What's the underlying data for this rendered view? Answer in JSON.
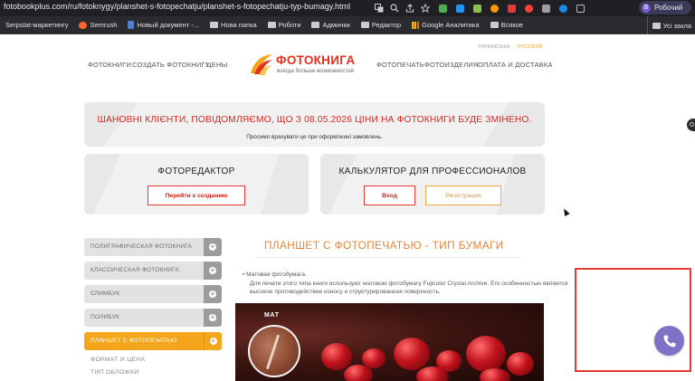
{
  "browser": {
    "url": "fotobookplus.com/ru/fotoknygy/planshet-s-fotopechatju/planshet-s-fotopechatju-typ-bumagy.html",
    "profile_initial": "В",
    "profile_label": "Робочий",
    "extensions": [
      {
        "name": "ext-icon-1",
        "color": "#4caf50"
      },
      {
        "name": "ext-icon-2",
        "color": "#2196f3"
      },
      {
        "name": "ext-icon-3",
        "color": "#8bc34a"
      },
      {
        "name": "ext-icon-4",
        "color": "#ff9800"
      },
      {
        "name": "ext-icon-5",
        "color": "#e53935"
      },
      {
        "name": "ext-icon-6",
        "color": "#f44336"
      },
      {
        "name": "ext-icon-7",
        "color": "#9e9e9e"
      },
      {
        "name": "ext-icon-8",
        "color": "#1e88e5"
      },
      {
        "name": "ext-icon-9",
        "color": "#bdbdbd"
      }
    ],
    "bookmarks": [
      {
        "label": "Serpstat-маркетингу",
        "icon": "none"
      },
      {
        "label": "Semrush",
        "icon": "sem"
      },
      {
        "label": "Новый документ -...",
        "icon": "doc"
      },
      {
        "label": "Нова папка",
        "icon": "folder"
      },
      {
        "label": "Роботи",
        "icon": "folder"
      },
      {
        "label": "Админки",
        "icon": "folder"
      },
      {
        "label": "Редактор",
        "icon": "folder"
      },
      {
        "label": "Google Аналитика",
        "icon": "chart"
      },
      {
        "label": "Всякое",
        "icon": "folder"
      }
    ],
    "all_bookmarks": "Усі закла"
  },
  "header": {
    "lang_ua": "УКРАЇНСЬКА",
    "lang_ru": "РУССКИЙ",
    "nav_left": [
      "ФОТОКНИГИ",
      "СОЗДАТЬ ФОТОКНИГУ",
      "ЦЕНЫ"
    ],
    "nav_right": [
      "ФОТОПЕЧАТЬ",
      "ФОТОИЗДЕЛИЯ",
      "ОПЛАТА И ДОСТАВКА"
    ],
    "logo_title": "ФОТОКНИГА",
    "logo_sub": "всегда больше возможностей"
  },
  "notice": {
    "title": "ШАНОВНІ КЛІЄНТИ, ПОВІДОМЛЯЄМО, ЩО З 08.05.2026 ЦІНИ НА ФОТОКНИГИ БУДЕ ЗМІНЕНО.",
    "subtitle": "Просимо врахувати це при оформленні замовлень."
  },
  "cards": {
    "editor_title": "ФОТОРЕДАКТОР",
    "editor_button": "Перейти к созданию",
    "calc_title": "КАЛЬКУЛЯТОР ДЛЯ ПРОФЕССИОНАЛОВ",
    "login_button": "Вход",
    "register_button": "Регистрация"
  },
  "sidebar": {
    "items": [
      {
        "label": "ПОЛИГРАФИЧЕСКАЯ ФОТОКНИГА",
        "active": false
      },
      {
        "label": "КЛАССИЧЕСКАЯ ФОТОКНИГА",
        "active": false
      },
      {
        "label": "СЛИМБУК",
        "active": false
      },
      {
        "label": "ПОЛИБУК",
        "active": false
      },
      {
        "label": "ПЛАНШЕТ С ФОТОПЕЧАТЬЮ",
        "active": true
      }
    ],
    "sub_links": [
      "ФОРМАТ И ЦЕНА",
      "ТИП ОБЛОЖКИ"
    ]
  },
  "main": {
    "title": "ПЛАНШЕТ С ФОТОПЕЧАТЬЮ - ТИП БУМАГИ",
    "bullet": "Матовая фотобумага.",
    "description": "Для печати этого  типа книги используют матовою фотобумагу Fujicolor Crystal Archive. Его особенностью является высокое противодействие износу и структурированная поверхность.",
    "photo_label": "МАТ"
  }
}
